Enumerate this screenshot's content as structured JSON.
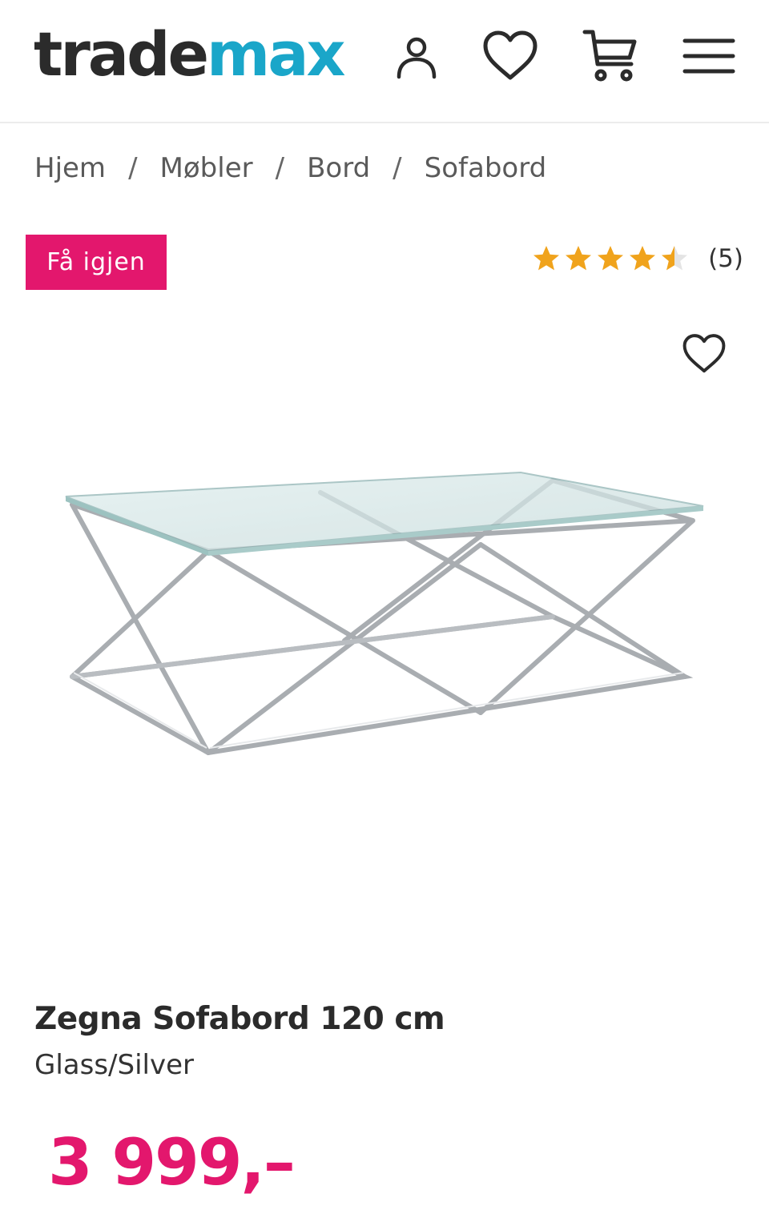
{
  "header": {
    "logo_part1": "trade",
    "logo_part2": "max",
    "icons": [
      "user-icon",
      "heart-icon",
      "cart-icon",
      "menu-icon"
    ]
  },
  "breadcrumb": [
    "Hjem",
    "Møbler",
    "Bord",
    "Sofabord"
  ],
  "badge": "Få igjen",
  "rating": {
    "stars": 4.5,
    "max": 5,
    "count": "(5)"
  },
  "product": {
    "title": "Zegna Sofabord 120 cm",
    "variant": "Glass/Silver",
    "price": "3 999,–"
  },
  "colors": {
    "accent": "#e3176d",
    "logo_blue": "#1aa6c9",
    "star": "#f0a31c"
  }
}
